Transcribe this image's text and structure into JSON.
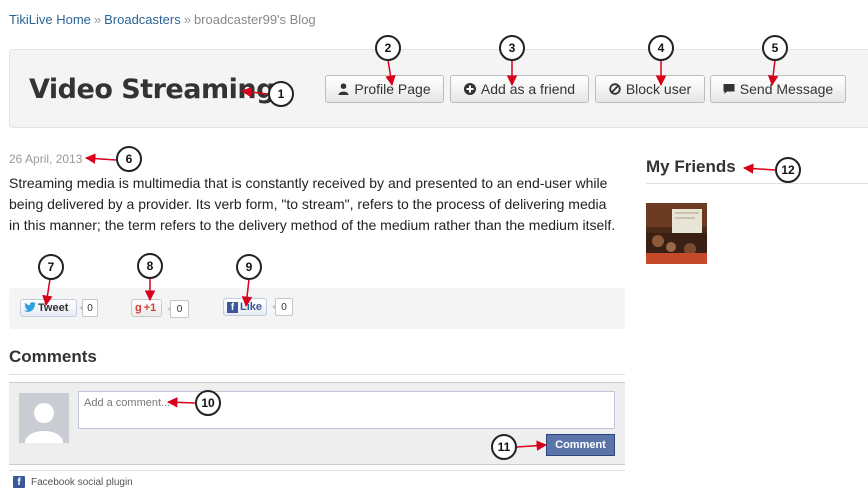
{
  "breadcrumb": {
    "home": "TikiLive Home",
    "separator": "»",
    "broadcasters": "Broadcasters",
    "current": "broadcaster99's Blog"
  },
  "header": {
    "title": "Video Streaming",
    "buttons": {
      "profile": "Profile Page",
      "add_friend": "Add as a friend",
      "block": "Block user",
      "message": "Send Message"
    }
  },
  "post": {
    "date": "26 April, 2013",
    "body": "Streaming media is multimedia that is constantly received by and presented to an end-user while being delivered by a provider. Its verb form, \"to stream\", refers to the process of delivering media in this manner; the term refers to the delivery method of the medium rather than the medium itself."
  },
  "share": {
    "tweet_label": "Tweet",
    "tweet_count": "0",
    "gplus_label": "+1",
    "gplus_count": "0",
    "like_label": "Like",
    "like_count": "0"
  },
  "comments": {
    "title": "Comments",
    "placeholder": "Add a comment...",
    "submit_label": "Comment",
    "plugin_label": "Facebook social plugin"
  },
  "sidebar": {
    "friends_title": "My Friends"
  },
  "callouts": [
    "1",
    "2",
    "3",
    "4",
    "5",
    "6",
    "7",
    "8",
    "9",
    "10",
    "11",
    "12"
  ],
  "colors": {
    "link": "#2a6496",
    "arrow": "#d9001b",
    "facebook_blue": "#5b74a8",
    "panel": "#f4f4f4"
  }
}
